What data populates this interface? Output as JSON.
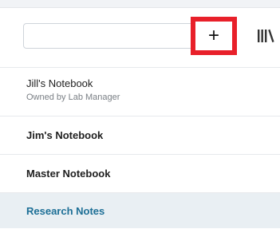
{
  "search": {
    "value": "",
    "placeholder": ""
  },
  "toolbar": {
    "add_label": "+",
    "add_icon": "plus-icon",
    "library_icon": "library-icon",
    "highlight_color": "#e8202a"
  },
  "notebooks": [
    {
      "name": "Jill's Notebook",
      "owner": "Owned by Lab Manager"
    },
    {
      "name": "Jim's Notebook"
    },
    {
      "name": "Master Notebook"
    },
    {
      "name": "Research Notes",
      "selected": true
    }
  ],
  "colors": {
    "selected_text": "#1d6f96",
    "selected_bg": "#e9eff3"
  }
}
